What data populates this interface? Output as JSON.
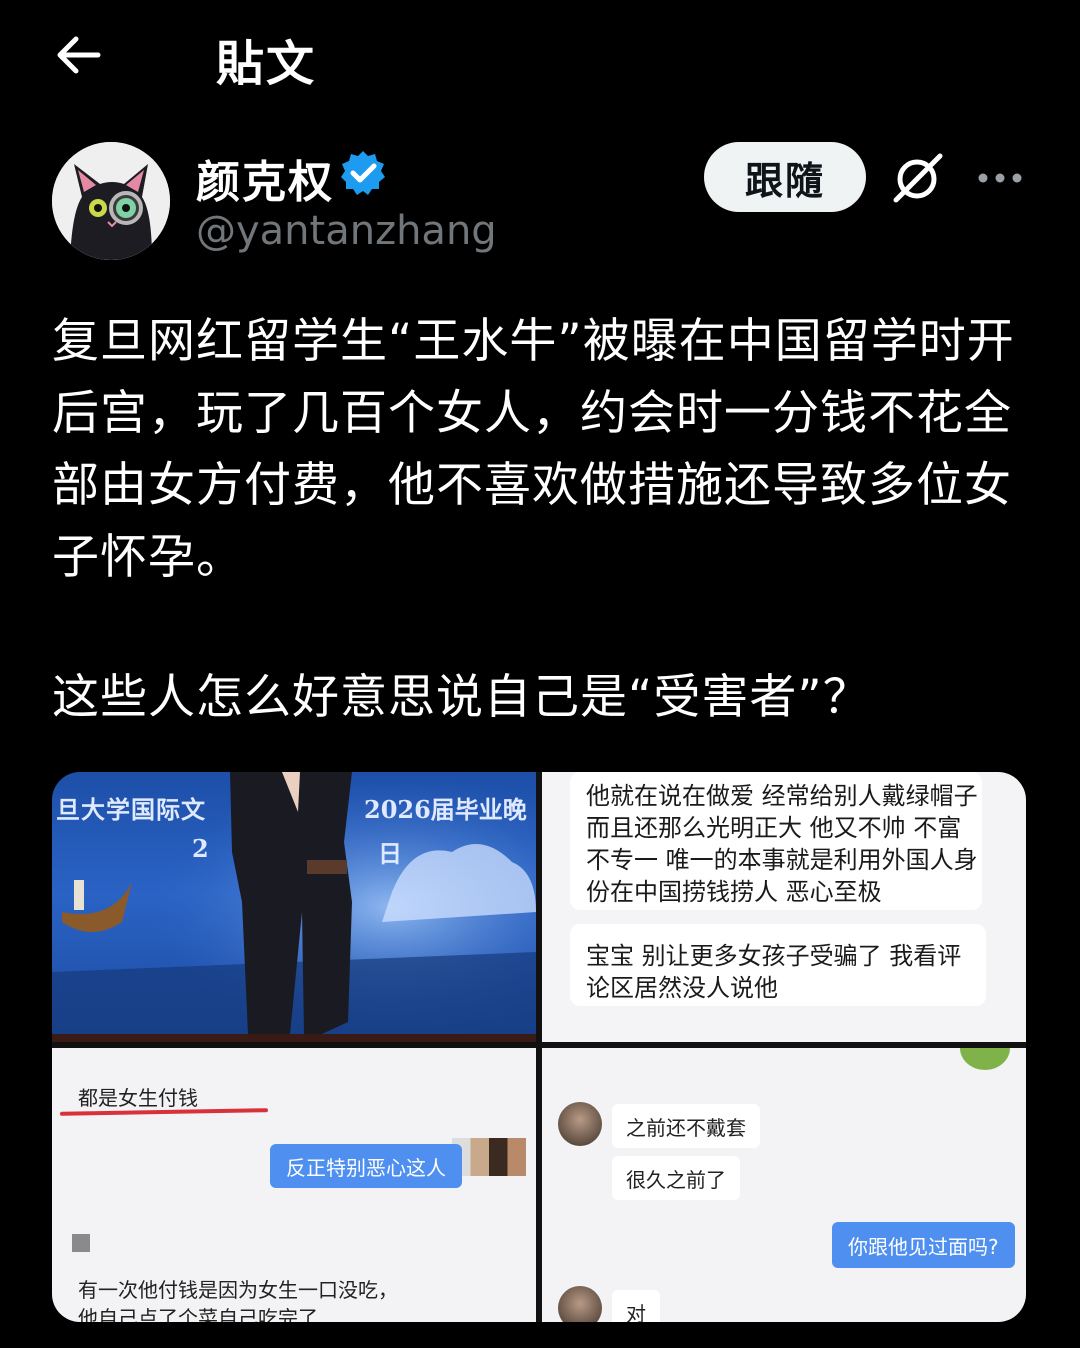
{
  "topbar": {
    "title": "貼文"
  },
  "author": {
    "name": "颜克权",
    "handle": "@yantanzhang",
    "verified": true,
    "follow_label": "跟隨"
  },
  "post": {
    "paragraph1": "复旦网红留学生“王水牛”被曝在中国留学时开后宫，玩了几百个女人，约会时一分钱不花全部由女方付费，他不喜欢做措施还导致多位女子怀孕。",
    "paragraph2": "这些人怎么好意思说自己是“受害者”？"
  },
  "media": {
    "image1": {
      "banner_left": "旦大学国际文",
      "banner_right": "2026届毕业晚",
      "banner_sub_left": "2",
      "banner_sub_right": "日"
    },
    "image2": {
      "msg1_lines": [
        "他就在说在做爱 经常给别人戴绿帽子",
        "而且还那么光明正大 他又不帅 不富",
        "不专一 唯一的本事就是利用外国人身",
        "份在中国捞钱捞人 恶心至极"
      ],
      "msg2_lines": [
        "宝宝 别让更多女孩子受骗了 我看评",
        "论区居然没人说他"
      ]
    },
    "image3": {
      "line1": "都是女生付钱",
      "bubble": "反正特别恶心这人",
      "line2a": "有一次他付钱是因为女生一口没吃，",
      "line2b": "他自己点了个菜自己吃完了"
    },
    "image4": {
      "msg1": "之前还不戴套",
      "msg2": "很久之前了",
      "reply": "你跟他见过面吗?",
      "msg3": "对"
    }
  },
  "colors": {
    "background": "#000000",
    "text": "#ffffff",
    "muted": "#71767b",
    "verified": "#1d9bf0",
    "follow_bg": "#eff3f4"
  },
  "icons": {
    "back": "arrow-left-icon",
    "verified": "verified-badge-icon",
    "grok": "grok-icon",
    "more": "more-horizontal-icon"
  }
}
